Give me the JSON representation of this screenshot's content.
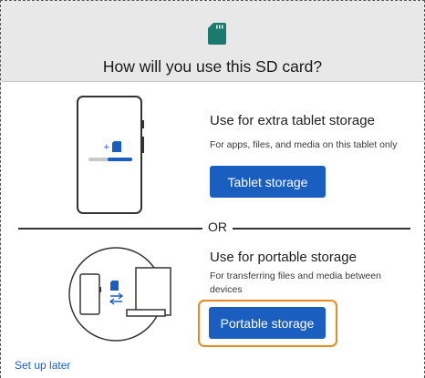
{
  "header": {
    "icon": "sd-card-icon",
    "title": "How will you use this SD card?"
  },
  "option_tablet": {
    "icon": "tablet-storage-illustration",
    "title": "Use for extra tablet storage",
    "description": "For apps, files, and media on this tablet only",
    "button_label": "Tablet storage"
  },
  "divider": {
    "label": "OR"
  },
  "option_portable": {
    "icon": "portable-storage-illustration",
    "title": "Use for portable storage",
    "description": "For transferring files and media between devices",
    "button_label": "Portable storage"
  },
  "footer": {
    "setup_later_label": "Set up later"
  },
  "colors": {
    "accent": "#1a5fc0",
    "focus": "#e98a1d",
    "sd_icon": "#1b7a6e",
    "header_bg": "#e8e8e8"
  }
}
